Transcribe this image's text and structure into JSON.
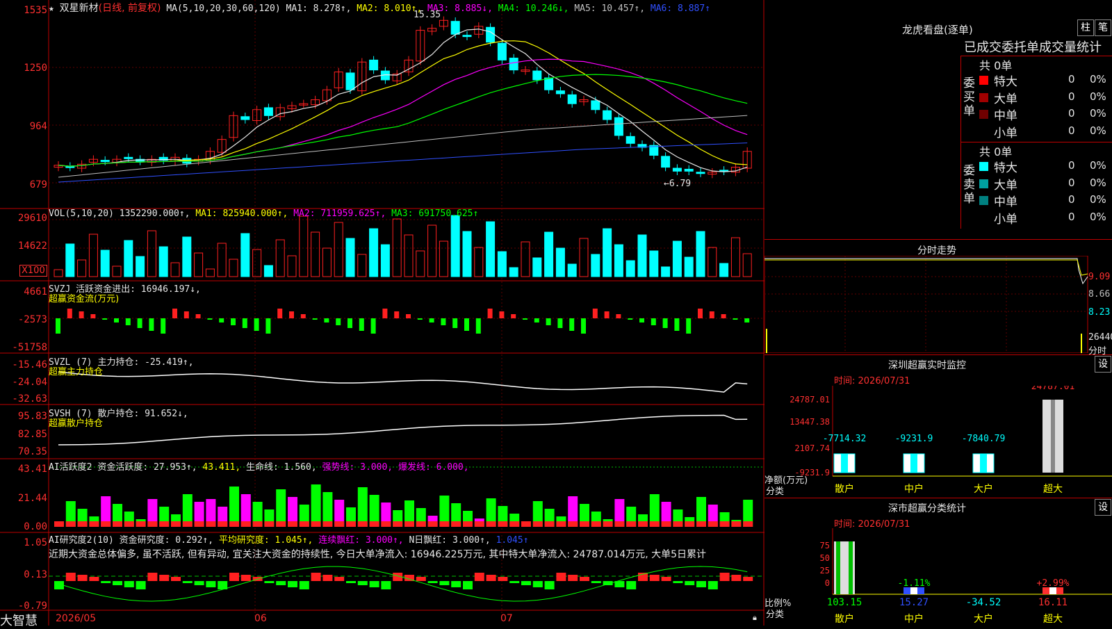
{
  "stock": {
    "name": "双星新材",
    "period": "(日线, 前复权)",
    "stars": "★",
    "ma_line": [
      {
        "t": "MA(5,10,20,30,60,120)",
        "c": "#e8e8e8"
      },
      {
        "t": "MA1: 8.278↑,",
        "c": "#e8e8e8"
      },
      {
        "t": "MA2: 8.010↑,",
        "c": "#ffff00"
      },
      {
        "t": "MA3: 8.885↓,",
        "c": "#ff00ff"
      },
      {
        "t": "MA4: 10.246↓,",
        "c": "#00ff00"
      },
      {
        "t": "MA5: 10.457↑,",
        "c": "#c0c0c0"
      },
      {
        "t": "MA6: 8.887↑",
        "c": "#3050ff"
      }
    ],
    "high_mark": "15.35",
    "low_mark": "←6.79"
  },
  "colors": {
    "up": "#ff2020",
    "down": "#00ffff",
    "grid": "#800000",
    "frame": "#c00000"
  },
  "price_axis": [
    "1535",
    "1250",
    "964",
    "679"
  ],
  "vol": {
    "header": [
      {
        "t": "VOL(5,10,20)",
        "c": "#e8e8e8"
      },
      {
        "t": "1352290.000↑,",
        "c": "#e8e8e8"
      },
      {
        "t": "MA1: 825940.000↑,",
        "c": "#ffff00"
      },
      {
        "t": "MA2: 711959.625↑,",
        "c": "#ff00ff"
      },
      {
        "t": "MA3: 691750.625↑",
        "c": "#00ff00"
      }
    ],
    "axis": [
      "29610",
      "14622"
    ],
    "unit": "X100"
  },
  "svzj": {
    "line1": [
      {
        "t": "SVZJ",
        "c": "#e8e8e8"
      },
      {
        "t": "活跃资金进出: 16946.197↓,",
        "c": "#e8e8e8"
      }
    ],
    "line2": "超赢资金流(万元)",
    "axis": [
      "4661",
      "-2573",
      "-51758"
    ]
  },
  "svzl": {
    "line1": [
      {
        "t": "SVZL (7)",
        "c": "#e8e8e8"
      },
      {
        "t": "主力持仓: -25.419↑,",
        "c": "#e8e8e8"
      }
    ],
    "line2": "超赢主力持仓",
    "axis": [
      "-15.46",
      "-24.04",
      "-32.63"
    ]
  },
  "svsh": {
    "line1": [
      {
        "t": "SVSH (7)",
        "c": "#e8e8e8"
      },
      {
        "t": "散户持仓: 91.652↓,",
        "c": "#e8e8e8"
      }
    ],
    "line2": "超赢散户持仓",
    "axis": [
      "95.83",
      "82.85",
      "70.35"
    ]
  },
  "ai1": {
    "line1": [
      {
        "t": "AI活跃度2",
        "c": "#e8e8e8"
      },
      {
        "t": "资金活跃度: 27.953↑,",
        "c": "#e8e8e8"
      },
      {
        "t": "43.411,",
        "c": "#ffff00"
      },
      {
        "t": "生命线: 1.560,",
        "c": "#e8e8e8"
      },
      {
        "t": "强势线: 3.000,",
        "c": "#ff00ff"
      },
      {
        "t": "爆发线: 6.000,",
        "c": "#ff00ff"
      }
    ],
    "axis": [
      "43.41",
      "21.44",
      "0.00"
    ]
  },
  "ai2": {
    "line1": [
      {
        "t": "AI研究度2(10)",
        "c": "#e8e8e8"
      },
      {
        "t": "资金研究度: 0.292↑,",
        "c": "#e8e8e8"
      },
      {
        "t": "平均研究度: 1.045↑,",
        "c": "#ffff00"
      },
      {
        "t": "连续飘红: 3.000↑,",
        "c": "#ff00ff"
      },
      {
        "t": "N日飘红: 3.000↑,",
        "c": "#e8e8e8"
      },
      {
        "t": "1.045↑",
        "c": "#3050ff"
      }
    ],
    "text": "近期大资金总体偏多, 虽不活跃, 但有异动, 宜关注大资金的持续性, 今日大单净流入: 16946.225万元, 其中特大单净流入: 24787.014万元, 大单5日累计",
    "axis": [
      "1.05",
      "0.13",
      "-0.79"
    ]
  },
  "xaxis": {
    "brand": "大智慧",
    "d1": "2026/05",
    "d2": "06",
    "d3": "07"
  },
  "right": {
    "lhb_title": "龙虎看盘(逐单)",
    "btn1": "柱",
    "btn2": "笔",
    "tabs_title": "已成交委托单成交量统计",
    "buy": {
      "label": "委买单",
      "total": "共 0单",
      "rows": [
        {
          "name": "特大",
          "n": "0",
          "p": "0%",
          "c": "#ff0000"
        },
        {
          "name": "大单",
          "n": "0",
          "p": "0%",
          "c": "#a00000"
        },
        {
          "name": "中单",
          "n": "0",
          "p": "0%",
          "c": "#700000"
        },
        {
          "name": "小单",
          "n": "0",
          "p": "0%",
          "c": "#000000"
        }
      ]
    },
    "sell": {
      "label": "委卖单",
      "total": "共 0单",
      "rows": [
        {
          "name": "特大",
          "n": "0",
          "p": "0%",
          "c": "#00ffff"
        },
        {
          "name": "大单",
          "n": "0",
          "p": "0%",
          "c": "#00a0a0"
        },
        {
          "name": "中单",
          "n": "0",
          "p": "0%",
          "c": "#008080"
        },
        {
          "name": "小单",
          "n": "0",
          "p": "0%",
          "c": "#000000"
        }
      ]
    },
    "fs_title": "分时走势",
    "fs_axis": [
      "9.09",
      "8.66",
      "8.23"
    ],
    "fs_vol": "26440",
    "fs_unit": "分时",
    "sz_title": "深圳超赢实时监控",
    "sz_set": "设",
    "sz_time": "时间: 2026/07/31",
    "sz_axis": [
      "24787.01",
      "13447.38",
      "2107.74",
      "-9231.9"
    ],
    "sz_values": [
      "-7714.32",
      "-9231.9",
      "-7840.79",
      "24787.01"
    ],
    "sz_ylabel": "净额(万元)",
    "sz_xlabel": "分类",
    "cats": [
      "散户",
      "中户",
      "大户",
      "超大"
    ],
    "fl_title": "深市超赢分类统计",
    "fl_set": "设",
    "fl_time": "时间: 2026/07/31",
    "fl_axis": [
      "75",
      "50",
      "25",
      "0"
    ],
    "fl_pct": [
      "",
      "-1.11%",
      "",
      "+2.99%"
    ],
    "fl_vals": [
      "103.15",
      "15.27",
      "-34.52",
      "16.11"
    ],
    "fl_ylabel": "比例%",
    "fl_xlabel": "分类"
  }
}
